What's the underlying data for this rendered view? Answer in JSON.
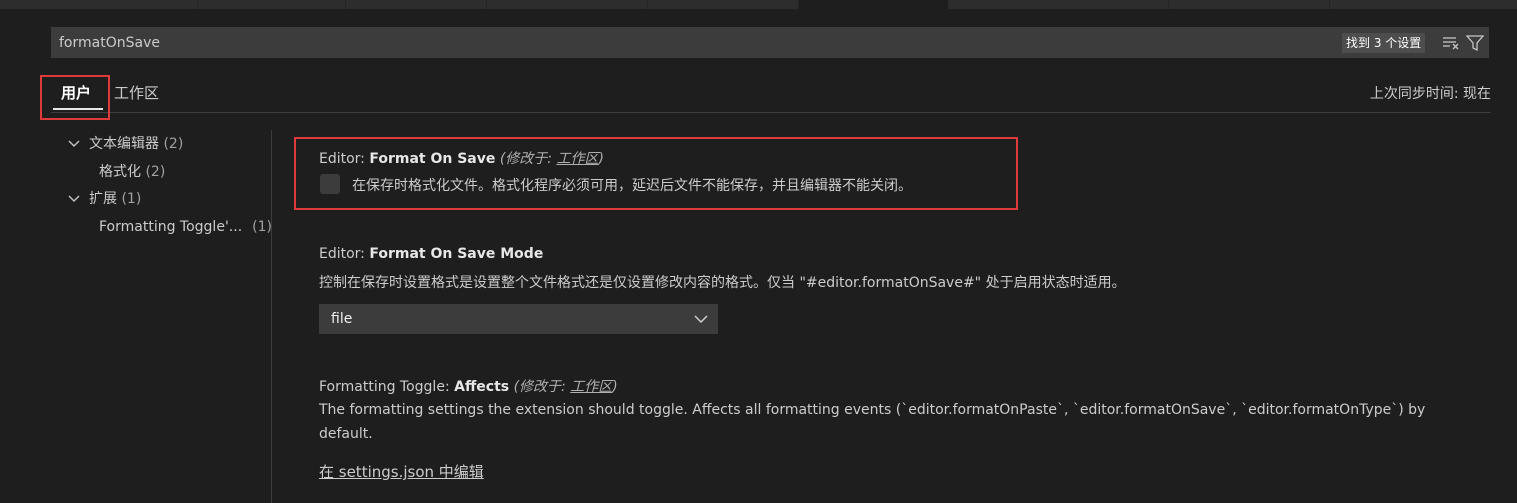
{
  "search": {
    "value": "formatOnSave",
    "result_count": "找到 3 个设置",
    "clear_filter_icon": "clear-filter-icon",
    "filter_icon": "filter-icon"
  },
  "tabs": {
    "user": "用户",
    "workspace": "工作区",
    "sync_status": "上次同步时间: 现在"
  },
  "toc": {
    "text_editor": {
      "label": "文本编辑器",
      "count": "(2)"
    },
    "formatting": {
      "label": "格式化",
      "count": "(2)"
    },
    "extensions": {
      "label": "扩展",
      "count": "(1)"
    },
    "formatting_toggle": {
      "label": "Formatting Toggle'...",
      "count": "(1)"
    }
  },
  "settings": {
    "format_on_save": {
      "category": "Editor: ",
      "name": "Format On Save",
      "modified_prefix": "(修改于: ",
      "modified_scope": "工作区",
      "modified_suffix": ")",
      "description": "在保存时格式化文件。格式化程序必须可用，延迟后文件不能保存，并且编辑器不能关闭。",
      "checked": false
    },
    "format_on_save_mode": {
      "category": "Editor: ",
      "name": "Format On Save Mode",
      "description": "控制在保存时设置格式是设置整个文件格式还是仅设置修改内容的格式。仅当 \"#editor.formatOnSave#\" 处于启用状态时适用。",
      "value": "file"
    },
    "formatting_toggle_affects": {
      "category": "Formatting Toggle: ",
      "name": "Affects",
      "modified_prefix": "(修改于: ",
      "modified_scope": "工作区",
      "modified_suffix": ")",
      "description_line1": "The formatting settings the extension should toggle. Affects all formatting events (`editor.formatOnPaste`, `editor.formatOnSave`, `editor.formatOnType`) by",
      "description_line2": "default.",
      "edit_link": "在 settings.json 中编辑"
    }
  },
  "colors": {
    "background": "#1e1e1e",
    "input": "#3c3c3c",
    "highlight": "#e03b3b"
  }
}
